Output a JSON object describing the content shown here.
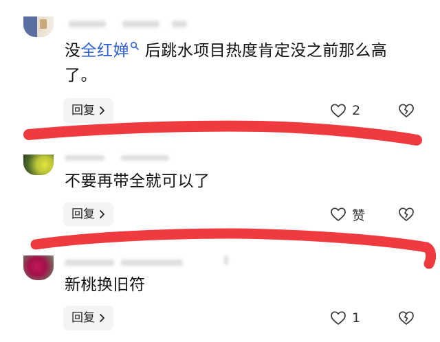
{
  "colors": {
    "mention": "#2f5fd0",
    "highlight_stroke": "#ef3b3f",
    "reply_bg": "#f4f4f4"
  },
  "comments": [
    {
      "text_before": "没",
      "mention": "全红婵",
      "text_after": " 后跳水项目热度肯定没之前那么高了。",
      "reply_label": "回复",
      "like_count": "2"
    },
    {
      "text": "不要再带全就可以了",
      "reply_label": "回复",
      "like_count": "赞"
    },
    {
      "text": "新桃换旧符",
      "reply_label": "回复",
      "like_count": "1"
    }
  ],
  "icons": {
    "like": "heart-outline-icon",
    "dislike": "broken-heart-icon",
    "reply_chevron": "chevron-right-icon",
    "mention_search": "search-icon"
  }
}
